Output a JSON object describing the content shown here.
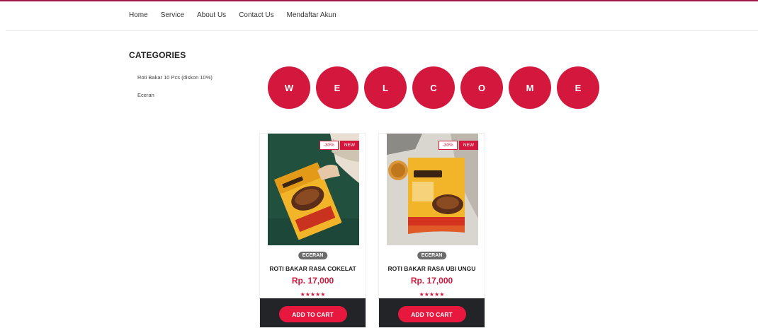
{
  "nav": {
    "items": [
      "Home",
      "Service",
      "About Us",
      "Contact Us",
      "Mendaftar Akun"
    ]
  },
  "sidebar": {
    "title": "CATEGORIES",
    "items": [
      "Roti Bakar 10 Pcs (diskon 10%)",
      "Eceran"
    ]
  },
  "welcome": {
    "letters": [
      "W",
      "E",
      "L",
      "C",
      "O",
      "M",
      "E"
    ]
  },
  "products": [
    {
      "sale_badge": "-30%",
      "new_badge": "NEW",
      "category": "ECERAN",
      "name": "ROTI BAKAR RASA COKELAT",
      "price": "Rp. 17,000",
      "stars": "★★★★★",
      "cta": "ADD TO CART",
      "image_icon": "product-photo-chocolate-box"
    },
    {
      "sale_badge": "-30%",
      "new_badge": "NEW",
      "category": "ECERAN",
      "name": "ROTI BAKAR RASA UBI UNGU",
      "price": "Rp. 17,000",
      "stars": "★★★★★",
      "cta": "ADD TO CART",
      "image_icon": "product-photo-ubi-ungu-box"
    }
  ],
  "colors": {
    "accent": "#d4183d",
    "button": "#e8173e",
    "card_footer": "#222428",
    "tag": "#6b6b6b"
  }
}
